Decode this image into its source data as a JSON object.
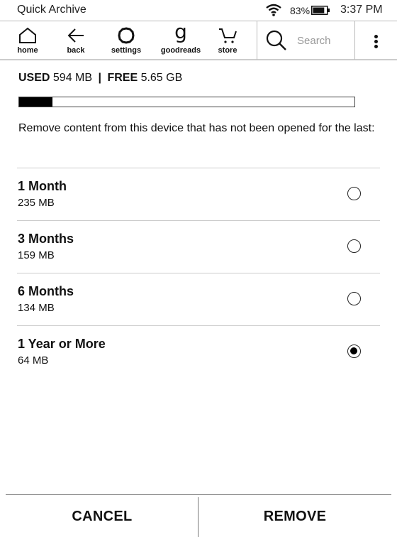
{
  "status_bar": {
    "title": "Quick Archive",
    "wifi_icon": "wifi-icon",
    "battery_percent": "83%",
    "battery_level": 0.83,
    "time": "3:37 PM"
  },
  "toolbar": {
    "items": [
      {
        "label": "home",
        "icon": "home-icon"
      },
      {
        "label": "back",
        "icon": "back-arrow-icon"
      },
      {
        "label": "settings",
        "icon": "gear-icon"
      },
      {
        "label": "goodreads",
        "icon": "goodreads-icon",
        "glyph": "g"
      },
      {
        "label": "store",
        "icon": "cart-icon"
      }
    ],
    "search": {
      "placeholder": "Search",
      "icon": "search-icon"
    },
    "menu_icon": "more-vertical-icon"
  },
  "storage": {
    "used_label": "USED",
    "used_value": "594 MB",
    "separator": "|",
    "free_label": "FREE",
    "free_value": "5.65 GB",
    "used_fraction": 0.1
  },
  "description": "Remove content from this device that has not been opened for the last:",
  "options": [
    {
      "label": "1 Month",
      "size": "235 MB",
      "selected": false
    },
    {
      "label": "3 Months",
      "size": "159 MB",
      "selected": false
    },
    {
      "label": "6 Months",
      "size": "134 MB",
      "selected": false
    },
    {
      "label": "1 Year or More",
      "size": "64 MB",
      "selected": true
    }
  ],
  "footer": {
    "cancel_label": "CANCEL",
    "remove_label": "REMOVE"
  }
}
